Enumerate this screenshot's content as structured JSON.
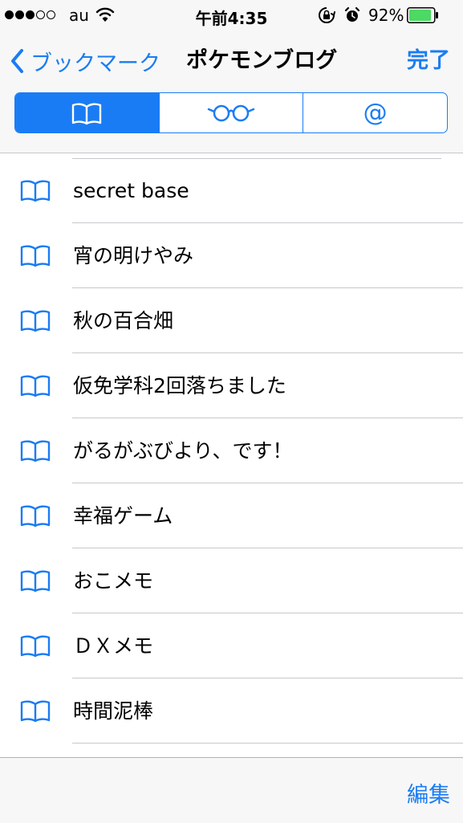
{
  "status_bar": {
    "carrier": "au",
    "time": "午前4:35",
    "battery_percent": "92%",
    "battery_level": 0.92,
    "signal_bars_filled": 3,
    "signal_bars_total": 5
  },
  "nav": {
    "back_label": "ブックマーク",
    "title": "ポケモンブログ",
    "done_label": "完了"
  },
  "segments": [
    {
      "icon": "book-icon",
      "selected": true
    },
    {
      "icon": "reading-glasses-icon",
      "selected": false
    },
    {
      "icon": "at-sign-icon",
      "label": "@",
      "selected": false
    }
  ],
  "bookmarks": [
    {
      "icon": "book-icon",
      "title": "secret base"
    },
    {
      "icon": "book-icon",
      "title": "宵の明けやみ"
    },
    {
      "icon": "book-icon",
      "title": "秋の百合畑"
    },
    {
      "icon": "book-icon",
      "title": "仮免学科2回落ちました"
    },
    {
      "icon": "book-icon",
      "title": "がるがぶびより、です！"
    },
    {
      "icon": "book-icon",
      "title": "幸福ゲーム"
    },
    {
      "icon": "book-icon",
      "title": "おこメモ"
    },
    {
      "icon": "book-icon",
      "title": "ＤＸメモ"
    },
    {
      "icon": "book-icon",
      "title": "時間泥棒"
    }
  ],
  "toolbar": {
    "edit_label": "編集"
  },
  "colors": {
    "accent": "#1a7cf4",
    "bar_background": "#f7f7f7",
    "separator": "#c8c7cc",
    "battery": "#4cd964"
  }
}
